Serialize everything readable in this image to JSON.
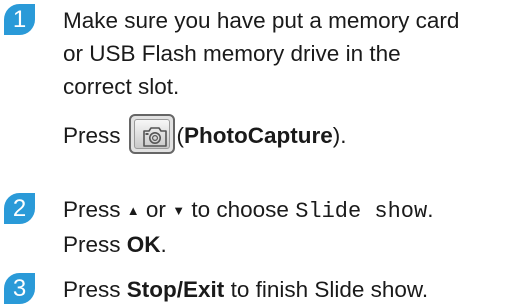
{
  "steps": [
    {
      "number": "1",
      "lines": [
        "Make sure you have put a memory card",
        "or USB Flash memory drive in the",
        "correct slot."
      ],
      "press_prefix": "Press",
      "button_icon": "camera-icon",
      "paren_open": "(",
      "button_name": "PhotoCapture",
      "paren_close": ")."
    },
    {
      "number": "2",
      "press": "Press",
      "up_arrow": "▲",
      "or": "or",
      "down_arrow": "▼",
      "to_choose": "to choose",
      "option": "Slide show",
      "press2": "Press",
      "ok": "OK",
      "period": "."
    },
    {
      "number": "3",
      "press": "Press",
      "key": "Stop/Exit",
      "rest": "to finish Slide show."
    }
  ],
  "colors": {
    "badge": "#2a9ad8",
    "text": "#1a1a1a"
  }
}
